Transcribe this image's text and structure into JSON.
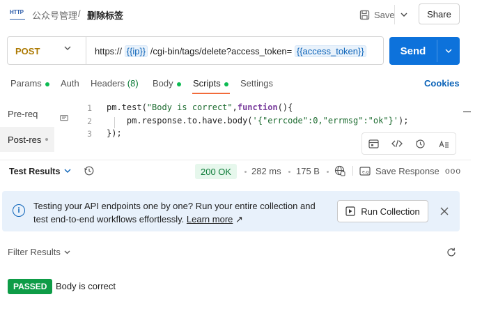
{
  "header": {
    "app_icon_label": "HTTP",
    "breadcrumb_collection": "公众号管理",
    "breadcrumb_separator": "/",
    "breadcrumb_request": "删除标签",
    "save_label": "Save",
    "share_label": "Share"
  },
  "request": {
    "method": "POST",
    "url_prefix": "https://",
    "url_var_ip": "{{ip}}",
    "url_middle": "/cgi-bin/tags/delete?access_token=",
    "url_var_token": "{{access_token}}",
    "send_label": "Send"
  },
  "tabs": {
    "params": "Params",
    "auth": "Auth",
    "headers": "Headers",
    "headers_count": "(8)",
    "body": "Body",
    "scripts": "Scripts",
    "settings": "Settings",
    "cookies": "Cookies"
  },
  "scripts": {
    "pre_request": "Pre-req",
    "post_response": "Post-res",
    "lines": {
      "n1": "1",
      "n2": "2",
      "n3": "3"
    },
    "code": {
      "l1_a": "pm.test(",
      "l1_str": "\"Body is correct\"",
      "l1_b": ",",
      "l1_kw": "function",
      "l1_c": "(){",
      "l2_a": "    pm.response.to.have.body(",
      "l2_str": "'{\"errcode\":0,\"errmsg\":\"ok\"}'",
      "l2_b": ");",
      "l3": "});"
    }
  },
  "response": {
    "test_results_label": "Test Results",
    "status": "200 OK",
    "time": "282 ms",
    "size": "175 B",
    "save_response_label": "Save Response",
    "more": "ooo"
  },
  "banner": {
    "text": "Testing your API endpoints one by one? Run your entire collection and test end-to-end workflows effortlessly.",
    "link": "Learn more",
    "link_arrow": "↗",
    "run_collection_label": "Run Collection"
  },
  "filter": {
    "label": "Filter Results"
  },
  "results": [
    {
      "status": "PASSED",
      "name": "Body is correct"
    }
  ],
  "colors": {
    "accent_blue": "#0d72db",
    "method_post": "#ad7a03",
    "status_green": "#0cbb52",
    "tab_underline": "#f26b3a"
  }
}
